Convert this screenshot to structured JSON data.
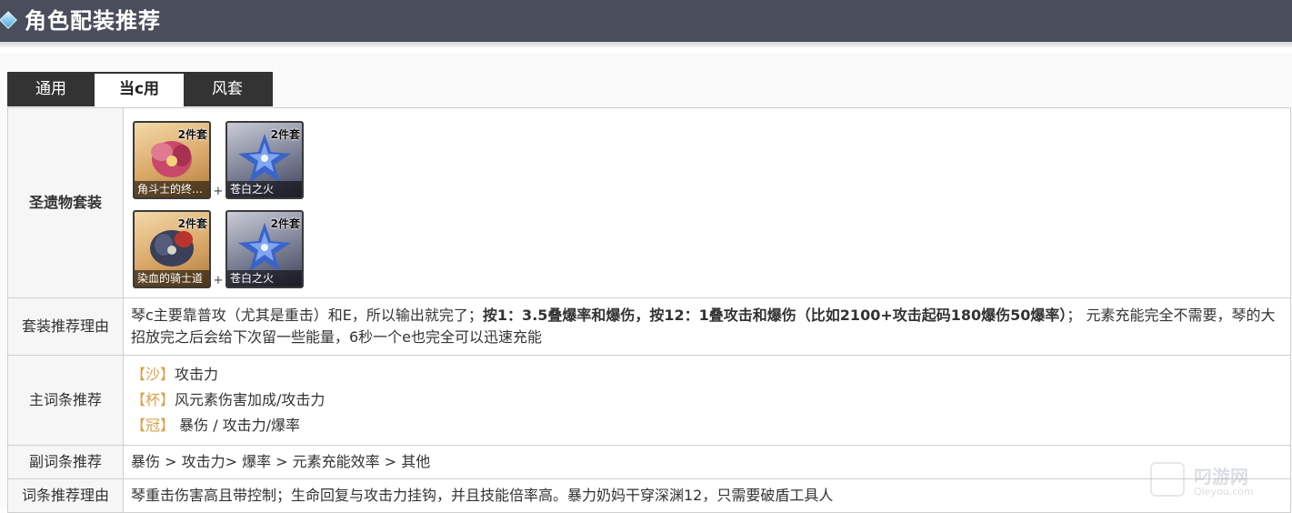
{
  "header": {
    "title": "角色配装推荐"
  },
  "tabs": [
    {
      "label": "通用",
      "active": false
    },
    {
      "label": "当c用",
      "active": true
    },
    {
      "label": "风套",
      "active": false
    }
  ],
  "artifacts": {
    "label": "圣遗物套装",
    "rows": [
      {
        "sets": [
          {
            "name": "角斗士的终…",
            "badge": "2件套",
            "icon": "gladiator-flower-icon",
            "color": "#c8486a"
          },
          {
            "name": "苍白之火",
            "badge": "2件套",
            "icon": "pale-flame-flower-icon",
            "color": "#3a64c8"
          }
        ],
        "plus": "+"
      },
      {
        "sets": [
          {
            "name": "染血的骑士道",
            "badge": "2件套",
            "icon": "bloodstained-chivalry-flower-icon",
            "color": "#3a3f5a"
          },
          {
            "name": "苍白之火",
            "badge": "2件套",
            "icon": "pale-flame-flower-icon",
            "color": "#3a64c8"
          }
        ],
        "plus": "+"
      }
    ]
  },
  "set_reason": {
    "label": "套装推荐理由",
    "text_before": "琴c主要靠普攻（尤其是重击）和E，所以输出就完了；",
    "text_bold": "按1：3.5叠爆率和爆伤，按12：1叠攻击和爆伤（比如2100+攻击起码180爆伤50爆率）",
    "text_after": "；  元素充能完全不需要，琴的大招放完之后会给下次留一些能量，6秒一个e也完全可以迅速充能"
  },
  "main_stats": {
    "label": "主词条推荐",
    "items": [
      {
        "tag": "【沙】",
        "value": "攻击力"
      },
      {
        "tag": "【杯】",
        "value": "风元素伤害加成/攻击力"
      },
      {
        "tag": "【冠】",
        "value": " 暴伤 / 攻击力/爆率"
      }
    ]
  },
  "sub_stats": {
    "label": "副词条推荐",
    "text": "暴伤 > 攻击力> 爆率 > 元素充能效率 > 其他"
  },
  "stat_reason": {
    "label": "词条推荐理由",
    "text": "琴重击伤害高且带控制；生命回复与攻击力挂钩，并且技能倍率高。暴力奶妈干穿深渊12，只需要破盾工具人"
  },
  "watermark": {
    "text": "叼游网",
    "sub": "Qleyou.com"
  },
  "colors": {
    "header_bg": "#4a4e5c",
    "tab_bar": "#333333",
    "stat_tag": "#d9a14a"
  }
}
